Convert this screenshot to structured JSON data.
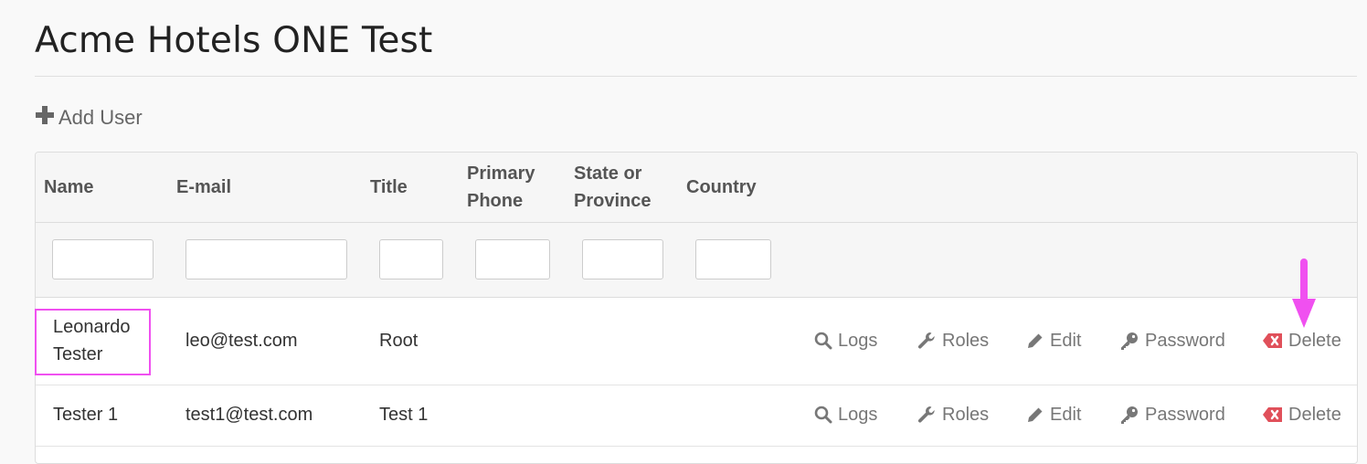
{
  "page": {
    "title": "Acme Hotels ONE Test"
  },
  "toolbar": {
    "add_user_label": "Add User"
  },
  "table": {
    "headers": {
      "name": "Name",
      "email": "E-mail",
      "title": "Title",
      "phone_line1": "Primary",
      "phone_line2": "Phone",
      "state_line1": "State or",
      "state_line2": "Province",
      "country": "Country"
    },
    "rows": [
      {
        "name_line1": "Leonardo",
        "name_line2": "Tester",
        "email": "leo@test.com",
        "title": "Root"
      },
      {
        "name_line1": "Tester 1",
        "name_line2": "",
        "email": "test1@test.com",
        "title": "Test 1"
      }
    ],
    "actions": {
      "logs": "Logs",
      "roles": "Roles",
      "edit": "Edit",
      "password": "Password",
      "delete": "Delete"
    }
  },
  "colors": {
    "highlight": "#f050f0",
    "delete_icon": "#e0505a",
    "action_text": "#777777"
  },
  "icons": [
    "plus-icon",
    "search-icon",
    "wrench-icon",
    "pencil-icon",
    "key-icon",
    "delete-x-icon",
    "arrow-down-icon"
  ]
}
